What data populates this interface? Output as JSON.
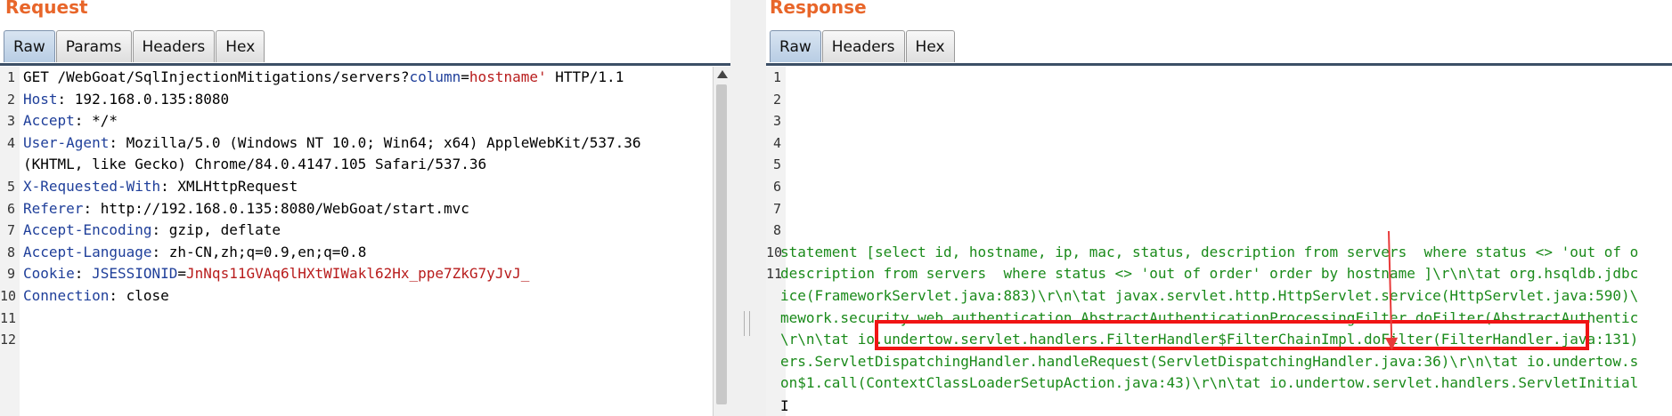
{
  "request": {
    "title": "Request",
    "tabs": [
      "Raw",
      "Params",
      "Headers",
      "Hex"
    ],
    "lines": [
      {
        "n": "1",
        "parts": [
          {
            "t": "GET /WebGoat/SqlInjectionMitigations/servers?",
            "c": "plain"
          },
          {
            "t": "column",
            "c": "pname"
          },
          {
            "t": "=",
            "c": "plain"
          },
          {
            "t": "hostname'",
            "c": "pval"
          },
          {
            "t": " HTTP/1.1",
            "c": "plain"
          }
        ]
      },
      {
        "n": "2",
        "parts": [
          {
            "t": "Host",
            "c": "hname"
          },
          {
            "t": ": 192.168.0.135:8080",
            "c": "plain"
          }
        ]
      },
      {
        "n": "3",
        "parts": [
          {
            "t": "Accept",
            "c": "hname"
          },
          {
            "t": ": */*",
            "c": "plain"
          }
        ]
      },
      {
        "n": "4",
        "parts": [
          {
            "t": "User-Agent",
            "c": "hname"
          },
          {
            "t": ": Mozilla/5.0 (Windows NT 10.0; Win64; x64) AppleWebKit/537.36",
            "c": "plain"
          }
        ]
      },
      {
        "n": "",
        "parts": [
          {
            "t": "(KHTML, like Gecko) Chrome/84.0.4147.105 Safari/537.36",
            "c": "plain"
          }
        ]
      },
      {
        "n": "5",
        "parts": [
          {
            "t": "X-Requested-With",
            "c": "hname"
          },
          {
            "t": ": XMLHttpRequest",
            "c": "plain"
          }
        ]
      },
      {
        "n": "6",
        "parts": [
          {
            "t": "Referer",
            "c": "hname"
          },
          {
            "t": ": http://192.168.0.135:8080/WebGoat/start.mvc",
            "c": "plain"
          }
        ]
      },
      {
        "n": "7",
        "parts": [
          {
            "t": "Accept-Encoding",
            "c": "hname"
          },
          {
            "t": ": gzip, deflate",
            "c": "plain"
          }
        ]
      },
      {
        "n": "8",
        "parts": [
          {
            "t": "Accept-Language",
            "c": "hname"
          },
          {
            "t": ": zh-CN,zh;q=0.9,en;q=0.8",
            "c": "plain"
          }
        ]
      },
      {
        "n": "9",
        "parts": [
          {
            "t": "Cookie",
            "c": "hname"
          },
          {
            "t": ": ",
            "c": "plain"
          },
          {
            "t": "JSESSIONID",
            "c": "pname"
          },
          {
            "t": "=",
            "c": "plain"
          },
          {
            "t": "JnNqs11GVAq6lHXtWIWakl62Hx_ppe7ZkG7yJvJ_",
            "c": "pval"
          }
        ]
      },
      {
        "n": "10",
        "parts": [
          {
            "t": "Connection",
            "c": "hname"
          },
          {
            "t": ": close",
            "c": "plain"
          }
        ]
      },
      {
        "n": "11",
        "parts": []
      },
      {
        "n": "12",
        "parts": []
      }
    ]
  },
  "response": {
    "title": "Response",
    "tabs": [
      "Raw",
      "Headers",
      "Hex"
    ],
    "lines": [
      {
        "n": "1",
        "t": ""
      },
      {
        "n": "2",
        "t": ""
      },
      {
        "n": "3",
        "t": ""
      },
      {
        "n": "4",
        "t": ""
      },
      {
        "n": "5",
        "t": ""
      },
      {
        "n": "6",
        "t": ""
      },
      {
        "n": "7",
        "t": ""
      },
      {
        "n": "8",
        "t": ""
      },
      {
        "n": "10",
        "t": "statement [select id, hostname, ip, mac, status, description from servers  where status <> 'out of o"
      },
      {
        "n": "11",
        "t": "description from servers  where status <> 'out of order' order by hostname ]\\r\\n\\tat org.hsqldb.jdbc"
      },
      {
        "n": "",
        "t": "ice(FrameworkServlet.java:883)\\r\\n\\tat javax.servlet.http.HttpServlet.service(HttpServlet.java:590)\\"
      },
      {
        "n": "",
        "t": "mework.security.web.authentication.AbstractAuthenticationProcessingFilter.doFilter(AbstractAuthentic"
      },
      {
        "n": "",
        "t": "\\r\\n\\tat io.undertow.servlet.handlers.FilterHandler$FilterChainImpl.doFilter(FilterHandler.java:131)"
      },
      {
        "n": "",
        "t": "ers.ServletDispatchingHandler.handleRequest(ServletDispatchingHandler.java:36)\\r\\n\\tat io.undertow.s"
      },
      {
        "n": "",
        "t": "on$1.call(ContextClassLoaderSetupAction.java:43)\\r\\n\\tat io.undertow.servlet.handlers.ServletInitial"
      }
    ]
  },
  "colors": {
    "accent": "#e8662a",
    "highlight_box": "#f01414",
    "response_text": "#1a8a1a"
  }
}
